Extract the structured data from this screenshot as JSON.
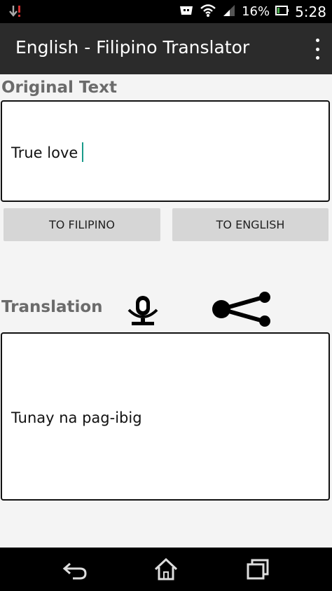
{
  "status_bar": {
    "battery_percent": "16%",
    "time": "5:28"
  },
  "app_bar": {
    "title": "English - Filipino Translator"
  },
  "original": {
    "label": "Original Text",
    "value": "True love"
  },
  "buttons": {
    "to_filipino": "TO FILIPINO",
    "to_english": "TO ENGLISH"
  },
  "translation": {
    "label": "Translation",
    "value": "Tunay na pag-ibig"
  },
  "colors": {
    "caret": "#1a9a8a",
    "app_bar": "#2b2b2b"
  }
}
